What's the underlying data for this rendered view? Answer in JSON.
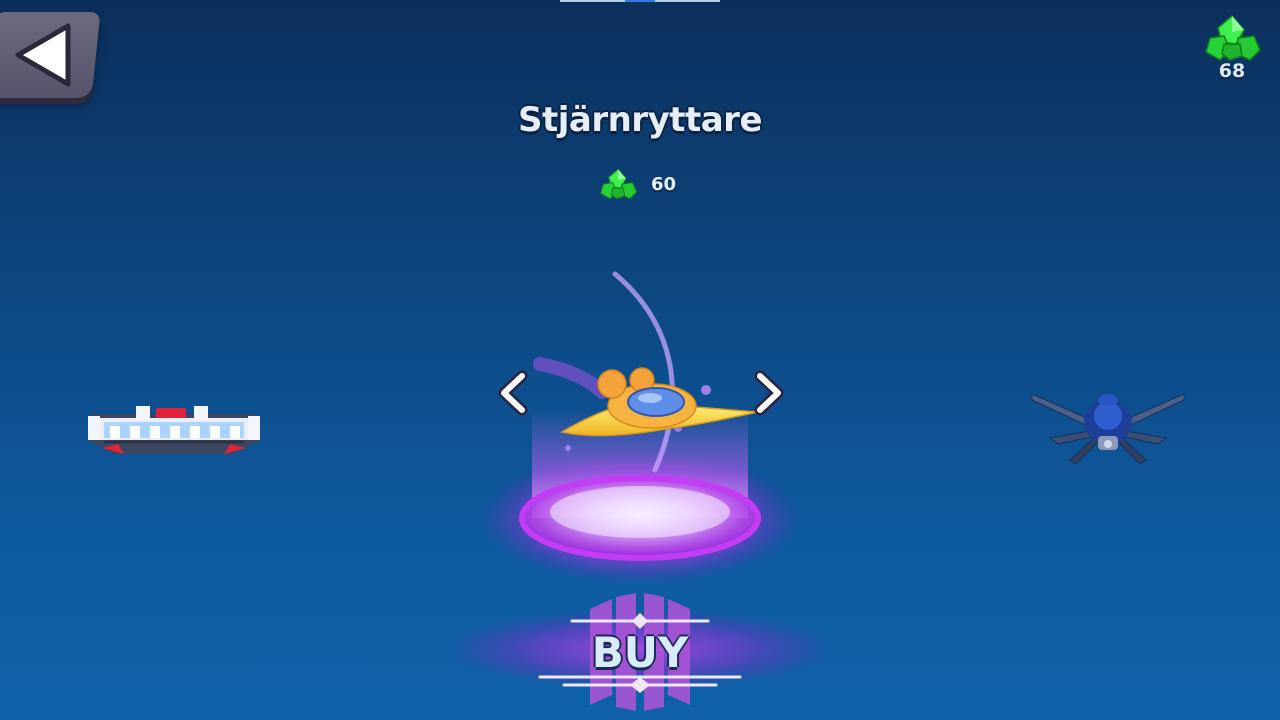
{
  "screen": {
    "item_name": "Stjärnryttare",
    "price": "60",
    "buy_label": "BUY"
  },
  "currency": {
    "icon": "green-gem-icon",
    "amount": "68"
  },
  "icons": {
    "back": "back-arrow-icon",
    "prev": "chevron-left-icon",
    "next": "chevron-right-icon"
  },
  "colors": {
    "gem": "#27d83a",
    "pedestal_glow": "#c23cf0",
    "buy_accent": "#9a3fd8",
    "background_top": "#0b2f5c",
    "background_bottom": "#0f62a8"
  }
}
